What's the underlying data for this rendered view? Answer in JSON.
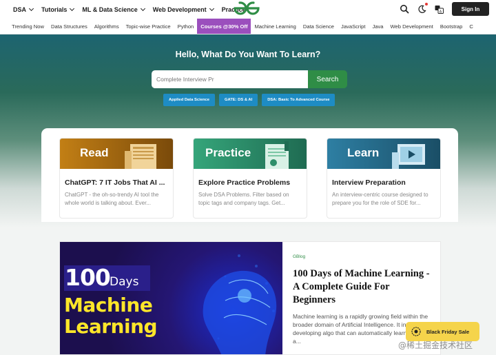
{
  "topnav": {
    "menu": [
      {
        "label": "DSA",
        "has_dropdown": true
      },
      {
        "label": "Tutorials",
        "has_dropdown": true
      },
      {
        "label": "ML & Data Science",
        "has_dropdown": true
      },
      {
        "label": "Web Development",
        "has_dropdown": true
      },
      {
        "label": "Practice",
        "has_dropdown": false
      }
    ],
    "logo_icon": "gfg-logo-icon",
    "signin_label": "Sign In"
  },
  "subnav": {
    "items": [
      "Trending Now",
      "Data Structures",
      "Algorithms",
      "Topic-wise Practice",
      "Python",
      "Courses @30% Off",
      "Machine Learning",
      "Data Science",
      "JavaScript",
      "Java",
      "Web Development",
      "Bootstrap",
      "C"
    ],
    "highlight_index": 5,
    "highlight_color": "#9b4fbd"
  },
  "hero": {
    "title": "Hello, What Do You Want To Learn?",
    "search_placeholder": "Complete Interview Pr",
    "search_button": "Search",
    "chips": [
      "Applied Data Science",
      "GATE: DS & AI",
      "DSA: Basic To Advanced Course"
    ]
  },
  "cards": [
    {
      "banner": "Read",
      "title": "ChatGPT: 7 IT Jobs That AI ...",
      "desc": "ChatGPT - the oh-so-trendy AI tool the whole world is talking about. Ever...",
      "color": "#a66a12"
    },
    {
      "banner": "Practice",
      "title": "Explore Practice Problems",
      "desc": "Solve DSA Problems. Filter based on topic tags and company tags. Get...",
      "color": "#2e8f6a"
    },
    {
      "banner": "Learn",
      "title": "Interview Preparation",
      "desc": "An interview-centric course designed to prepare you for the role of SDE for...",
      "color": "#236a86"
    }
  ],
  "article": {
    "image_lines": {
      "num": "100",
      "days": "Days",
      "line1": "Machine",
      "line2": "Learning"
    },
    "tag": "GBlog",
    "title": "100 Days of Machine Learning - A Complete Guide For Beginners",
    "desc": "Machine learning is a rapidly growing field within the broader domain of Artificial Intelligence. It involves developing algo that can automatically learn patterns a..."
  },
  "black_friday": {
    "label": "Black Friday Sale"
  },
  "watermark": "@稀土掘金技术社区",
  "colors": {
    "brand_green": "#2f8d46",
    "chip_blue": "#1e8cc4",
    "signin_bg": "#222222"
  }
}
